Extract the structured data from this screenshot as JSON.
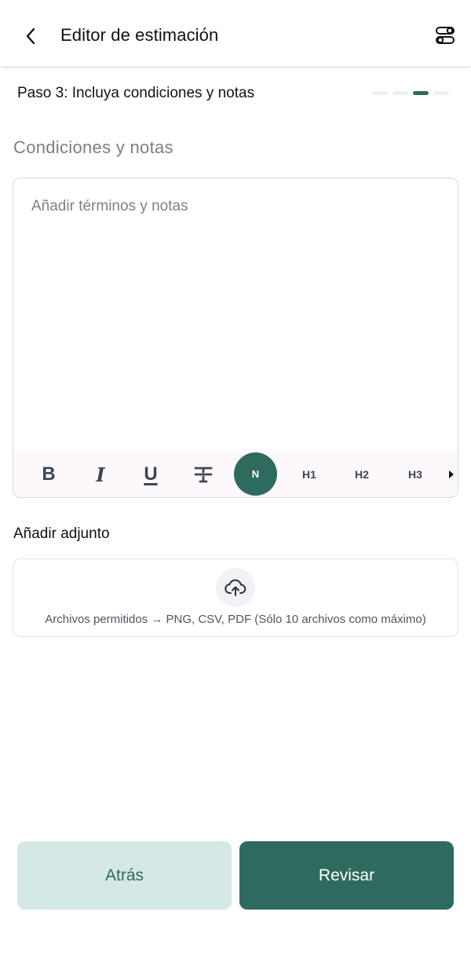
{
  "header": {
    "title": "Editor de estimación",
    "back_icon": "chevron-left-icon",
    "settings_icon": "toggle-settings-icon"
  },
  "step": {
    "title": "Paso 3: Incluya condiciones y notas",
    "total_steps": 4,
    "current_step": 3
  },
  "notes": {
    "section_label": "Condiciones y notas",
    "placeholder": "Añadir términos y notas",
    "value": ""
  },
  "toolbar": {
    "bold": "B",
    "italic": "I",
    "underline": "U",
    "strikethrough": "T",
    "normal": "N",
    "h1": "H1",
    "h2": "H2",
    "h3": "H3",
    "selected": "N"
  },
  "attachment": {
    "label": "Añadir adjunto",
    "hint": "Archivos permitidos → PNG, CSV, PDF (Sólo 10 archivos como máximo)",
    "icon": "cloud-upload-icon"
  },
  "actions": {
    "back_label": "Atrás",
    "review_label": "Revisar"
  },
  "colors": {
    "primary": "#2e6b5e",
    "primary_light": "#d4e8e5",
    "toolbar_bg": "#fcf8fc"
  }
}
